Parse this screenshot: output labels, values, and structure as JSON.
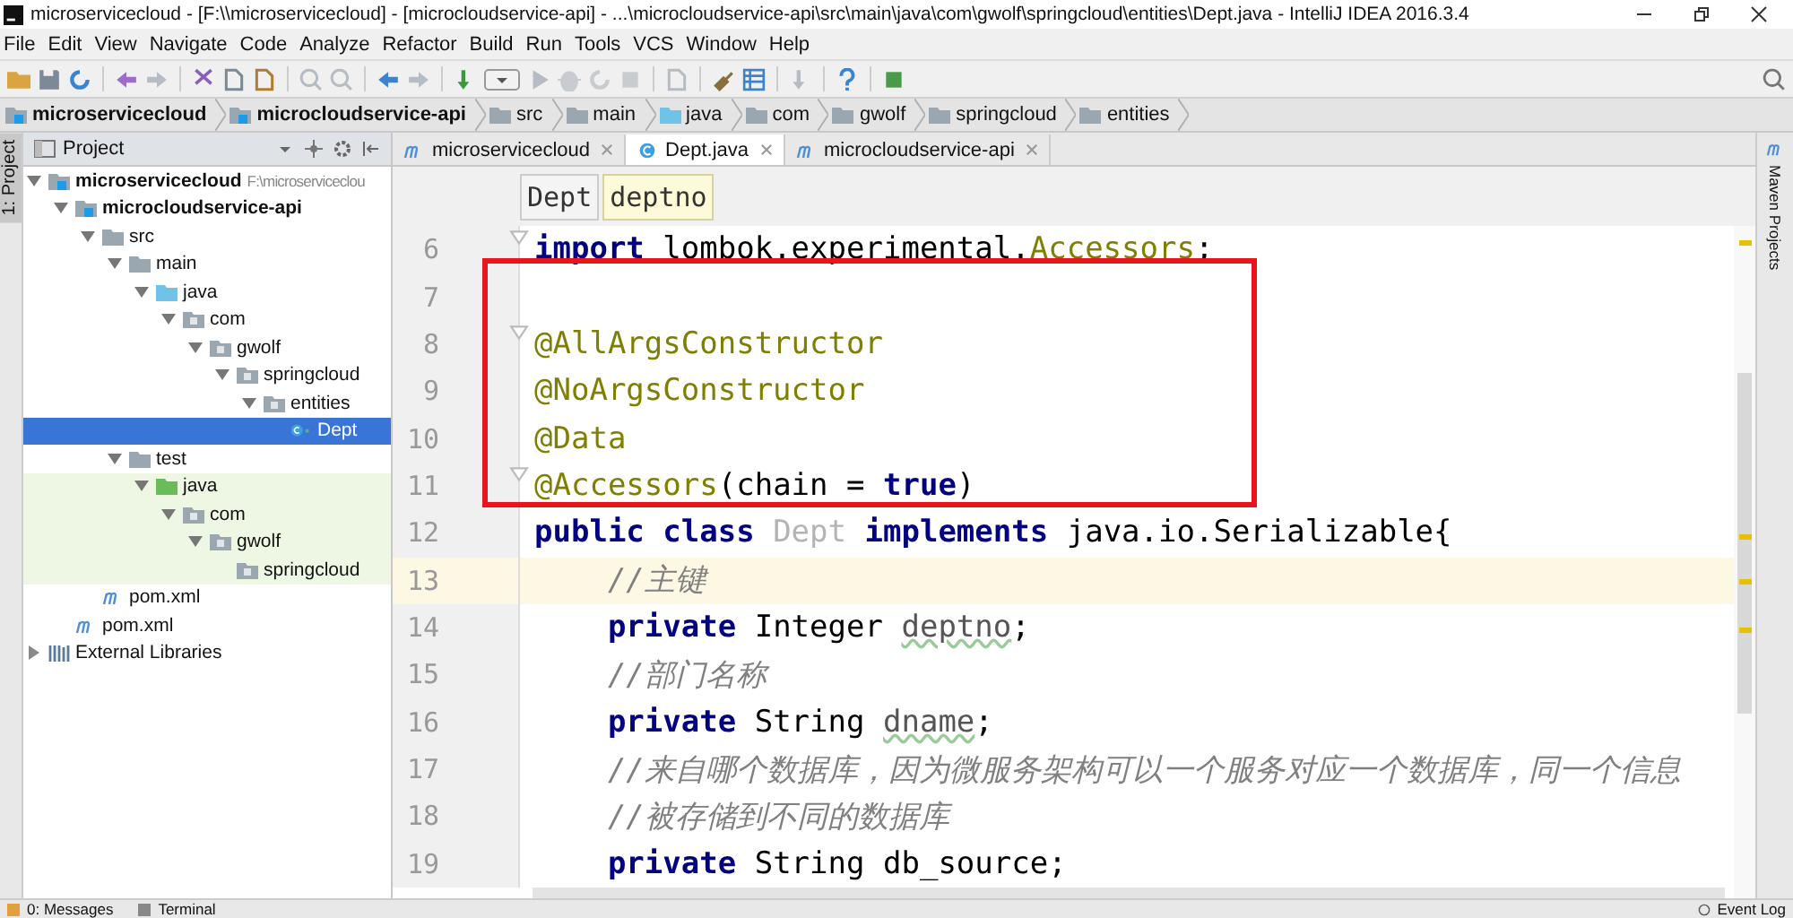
{
  "window": {
    "title": "microservicecloud - [F:\\\\microservicecloud] - [microcloudservice-api] - ...\\microcloudservice-api\\src\\main\\java\\com\\gwolf\\springcloud\\entities\\Dept.java - IntelliJ IDEA 2016.3.4"
  },
  "menu": [
    "File",
    "Edit",
    "View",
    "Navigate",
    "Code",
    "Analyze",
    "Refactor",
    "Build",
    "Run",
    "Tools",
    "VCS",
    "Window",
    "Help"
  ],
  "navigation_bar": [
    {
      "label": "microservicecloud",
      "kind": "module"
    },
    {
      "label": "microcloudservice-api",
      "kind": "module"
    },
    {
      "label": "src",
      "kind": "folder"
    },
    {
      "label": "main",
      "kind": "folder"
    },
    {
      "label": "java",
      "kind": "source-folder"
    },
    {
      "label": "com",
      "kind": "folder"
    },
    {
      "label": "gwolf",
      "kind": "folder"
    },
    {
      "label": "springcloud",
      "kind": "folder"
    },
    {
      "label": "entities",
      "kind": "folder"
    }
  ],
  "left_stripe": [
    {
      "label": "1: Project",
      "selected": true
    }
  ],
  "right_stripe": [
    {
      "label": "Maven Projects"
    }
  ],
  "project_panel": {
    "title": "Project",
    "tree": [
      {
        "label": "microservicecloud",
        "hint": "F:\\microserviceclou",
        "kind": "module",
        "expanded": true,
        "selected": false,
        "test_scope": false,
        "children": [
          {
            "label": "microcloudservice-api",
            "kind": "module",
            "expanded": true,
            "selected": false,
            "test_scope": false,
            "children": [
              {
                "label": "src",
                "kind": "folder",
                "expanded": true,
                "selected": false,
                "test_scope": false,
                "children": [
                  {
                    "label": "main",
                    "kind": "folder",
                    "expanded": true,
                    "selected": false,
                    "test_scope": false,
                    "children": [
                      {
                        "label": "java",
                        "kind": "source-folder",
                        "expanded": true,
                        "selected": false,
                        "test_scope": false,
                        "children": [
                          {
                            "label": "com",
                            "kind": "package",
                            "expanded": true,
                            "selected": false,
                            "test_scope": false,
                            "children": [
                              {
                                "label": "gwolf",
                                "kind": "package",
                                "expanded": true,
                                "selected": false,
                                "test_scope": false,
                                "children": [
                                  {
                                    "label": "springcloud",
                                    "kind": "package",
                                    "expanded": true,
                                    "selected": false,
                                    "test_scope": false,
                                    "children": [
                                      {
                                        "label": "entities",
                                        "kind": "package",
                                        "expanded": true,
                                        "selected": false,
                                        "test_scope": false,
                                        "children": [
                                          {
                                            "label": "Dept",
                                            "kind": "class",
                                            "selected": true,
                                            "test_scope": false
                                          }
                                        ]
                                      }
                                    ]
                                  }
                                ]
                              }
                            ]
                          }
                        ]
                      }
                    ]
                  },
                  {
                    "label": "test",
                    "kind": "folder",
                    "expanded": true,
                    "selected": false,
                    "test_scope": false,
                    "children": [
                      {
                        "label": "java",
                        "kind": "test-folder",
                        "expanded": true,
                        "selected": false,
                        "test_scope": true,
                        "children": [
                          {
                            "label": "com",
                            "kind": "package",
                            "expanded": true,
                            "selected": false,
                            "test_scope": true,
                            "children": [
                              {
                                "label": "gwolf",
                                "kind": "package",
                                "expanded": true,
                                "selected": false,
                                "test_scope": true,
                                "children": [
                                  {
                                    "label": "springcloud",
                                    "kind": "package",
                                    "selected": false,
                                    "test_scope": true
                                  }
                                ]
                              }
                            ]
                          }
                        ]
                      }
                    ]
                  }
                ]
              },
              {
                "label": "pom.xml",
                "kind": "maven",
                "selected": false,
                "test_scope": false
              }
            ]
          },
          {
            "label": "pom.xml",
            "kind": "maven",
            "selected": false,
            "test_scope": false
          }
        ]
      },
      {
        "label": "External Libraries",
        "kind": "libraries",
        "expanded": false,
        "selected": false,
        "test_scope": false
      }
    ]
  },
  "editor": {
    "tabs": [
      {
        "label": "microservicecloud",
        "kind": "maven",
        "selected": false
      },
      {
        "label": "Dept.java",
        "kind": "class",
        "selected": true
      },
      {
        "label": "microcloudservice-api",
        "kind": "maven",
        "selected": false
      }
    ],
    "breadcrumbs": [
      {
        "label": "Dept",
        "selected": false
      },
      {
        "label": "deptno",
        "selected": true
      }
    ],
    "lines": [
      {
        "number": "6",
        "current": false,
        "fold": true,
        "tokens": [
          {
            "kind": "keyword",
            "text": "import"
          },
          {
            "kind": "plain",
            "text": " lombok.experimental."
          },
          {
            "kind": "annotation",
            "text": "Accessors"
          },
          {
            "kind": "plain",
            "text": ";"
          }
        ]
      },
      {
        "number": "7",
        "current": false,
        "fold": false
      },
      {
        "number": "8",
        "current": false,
        "fold": true,
        "tokens": [
          {
            "kind": "annotation",
            "text": "@AllArgsConstructor"
          }
        ]
      },
      {
        "number": "9",
        "current": false,
        "fold": false,
        "tokens": [
          {
            "kind": "annotation",
            "text": "@NoArgsConstructor"
          }
        ]
      },
      {
        "number": "10",
        "current": false,
        "fold": false,
        "tokens": [
          {
            "kind": "annotation",
            "text": "@Data"
          }
        ]
      },
      {
        "number": "11",
        "current": false,
        "fold": true,
        "tokens": [
          {
            "kind": "annotation",
            "text": "@Accessors"
          },
          {
            "kind": "plain",
            "text": "(chain = "
          },
          {
            "kind": "keyword",
            "text": "true"
          },
          {
            "kind": "plain",
            "text": ")"
          }
        ]
      },
      {
        "number": "12",
        "current": false,
        "fold": false,
        "tokens": [
          {
            "kind": "keyword",
            "text": "public class "
          },
          {
            "kind": "unused",
            "text": "Dept"
          },
          {
            "kind": "keyword",
            "text": " implements "
          },
          {
            "kind": "plain",
            "text": "java.io.Serializable{"
          }
        ]
      },
      {
        "number": "13",
        "current": true,
        "fold": false,
        "tokens": [
          {
            "kind": "comment",
            "text": "    //主键"
          }
        ]
      },
      {
        "number": "14",
        "current": false,
        "fold": false,
        "tokens": [
          {
            "kind": "keyword",
            "text": "    private"
          },
          {
            "kind": "plain",
            "text": " Integer "
          },
          {
            "kind": "field",
            "text": "deptno"
          },
          {
            "kind": "plain",
            "text": ";"
          }
        ]
      },
      {
        "number": "15",
        "current": false,
        "fold": false,
        "tokens": [
          {
            "kind": "comment",
            "text": "    //部门名称"
          }
        ]
      },
      {
        "number": "16",
        "current": false,
        "fold": false,
        "tokens": [
          {
            "kind": "keyword",
            "text": "    private"
          },
          {
            "kind": "plain",
            "text": " String "
          },
          {
            "kind": "field",
            "text": "dname"
          },
          {
            "kind": "plain",
            "text": ";"
          }
        ]
      },
      {
        "number": "17",
        "current": false,
        "fold": false,
        "tokens": [
          {
            "kind": "comment",
            "text": "    //来自哪个数据库，因为微服务架构可以一个服务对应一个数据库，同一个信息"
          }
        ]
      },
      {
        "number": "18",
        "current": false,
        "fold": false,
        "tokens": [
          {
            "kind": "comment",
            "text": "    //被存储到不同的数据库"
          }
        ]
      },
      {
        "number": "19",
        "current": false,
        "fold": false,
        "tokens": [
          {
            "kind": "keyword",
            "text": "    private"
          },
          {
            "kind": "plain",
            "text": " String "
          },
          {
            "kind": "plain",
            "text": "db_source;"
          }
        ]
      }
    ]
  },
  "bottom_bar": {
    "tools": [
      {
        "label": "0: Messages",
        "kind": "messages"
      },
      {
        "label": "Terminal",
        "kind": "terminal"
      }
    ],
    "event_log": "Event Log"
  }
}
